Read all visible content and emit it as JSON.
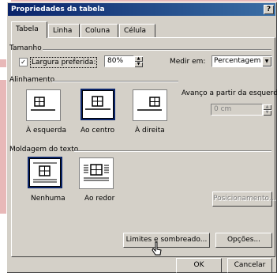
{
  "window": {
    "title": "Propriedades da tabela",
    "help": "?"
  },
  "tabs": [
    {
      "label": "Tabela",
      "active": true
    },
    {
      "label": "Linha",
      "active": false
    },
    {
      "label": "Coluna",
      "active": false
    },
    {
      "label": "Célula",
      "active": false
    }
  ],
  "tamanho": {
    "group_label": "Tamanho",
    "preferred_width_label": "Largura preferida:",
    "preferred_width_checked": true,
    "preferred_width_value": "80%",
    "measure_label": "Medir em:",
    "measure_value": "Percentagem"
  },
  "alinhamento": {
    "group_label": "Alinhamento",
    "options": [
      "À esquerda",
      "Ao centro",
      "À direita"
    ],
    "selected": "Ao centro",
    "indent_label": "Avanço a partir da esquerda:",
    "indent_value": "0 cm"
  },
  "moldagem": {
    "group_label": "Moldagem do texto",
    "options": [
      "Nenhuma",
      "Ao redor"
    ],
    "selected": "Nenhuma",
    "position_button": "Posicionamento..."
  },
  "buttons": {
    "borders": "Limites e sombreado...",
    "options": "Opções...",
    "ok": "OK",
    "cancel": "Cancelar"
  }
}
